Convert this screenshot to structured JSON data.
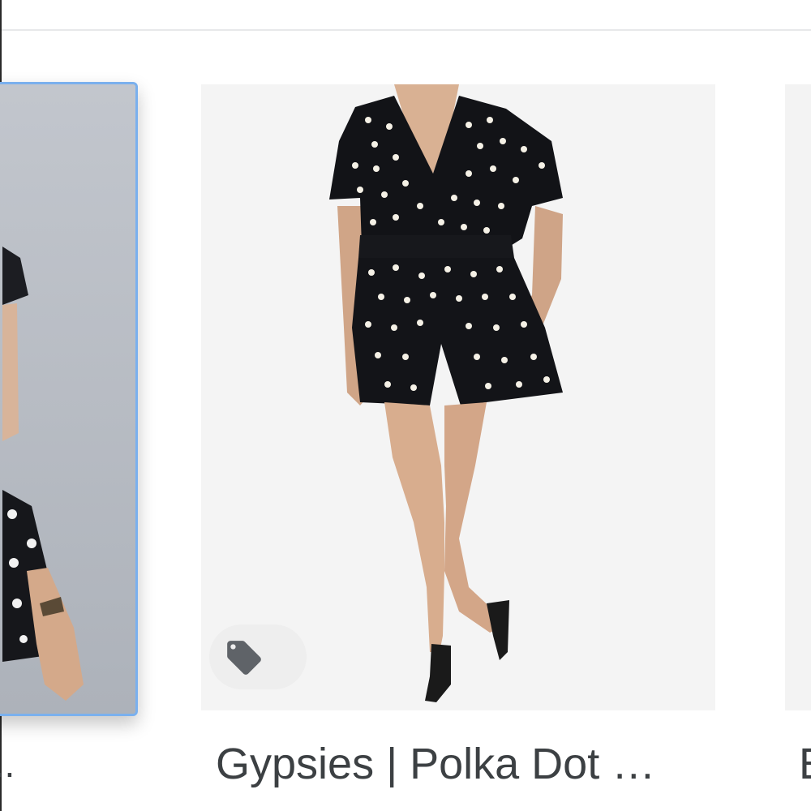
{
  "cards": [
    {
      "title": "...",
      "selected": true
    },
    {
      "title": "Gypsies | Polka Dot …",
      "selected": false,
      "badge_icon": "price-tag-icon"
    },
    {
      "title": "E",
      "selected": false
    }
  ],
  "colors": {
    "selected_border": "#7ab0ee",
    "title_text": "#3c4043",
    "icon_gray": "#5f6368",
    "image_bg": "#f4f4f4"
  }
}
